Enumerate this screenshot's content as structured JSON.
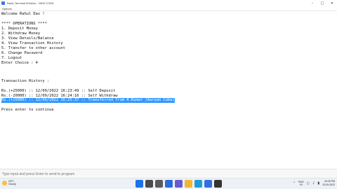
{
  "window": {
    "title": "Basic Terminal Window - NEW CODE",
    "menu": "Options"
  },
  "console": {
    "lines": [
      "Welcome Rahul Das !",
      "",
      "**** OPERATIONS ****",
      "1. Deposit Money",
      "2. Withdraw Money",
      "3. View Details/Balance",
      "4. View Transaction History",
      "5. Transfer to other account",
      "6. Change Password",
      "7. Logout",
      "Enter Choice : 4",
      "",
      "Transaction History :",
      "Rs.(+25000) :: 12/09/2022 16:23:49 :: Self Deposit",
      "Rs.(-20000) :: 12/09/2022 16:24:16 :: Self Withdraw",
      "Rs.(+15000) :: 12/09/2022 16:25:37 :: Transferred from K.Kumar (Aaryan Cuba)",
      "",
      "Press enter to continue"
    ],
    "selected_line_index": 15
  },
  "input": {
    "placeholder": "Type input and press Enter to send to program"
  },
  "taskbar": {
    "weather_temp": "29°C",
    "weather_desc": "Cloudy",
    "language": [
      "ENG",
      "IN"
    ],
    "time": "04:25 PM",
    "date": "12-09-2022",
    "pinned_icons": [
      {
        "name": "windows-start-icon",
        "color": "#1a73e8"
      },
      {
        "name": "search-icon",
        "color": "#4a4a4a"
      },
      {
        "name": "task-view-icon",
        "color": "#5a5a5a"
      },
      {
        "name": "widgets-icon",
        "color": "#2b6cd8"
      },
      {
        "name": "chat-icon",
        "color": "#6a5acd"
      },
      {
        "name": "file-explorer-icon",
        "color": "#f2b632"
      },
      {
        "name": "edge-icon",
        "color": "#1f9bd9"
      },
      {
        "name": "store-icon",
        "color": "#2f6fe0"
      },
      {
        "name": "terminal-icon",
        "color": "#333333"
      }
    ]
  }
}
